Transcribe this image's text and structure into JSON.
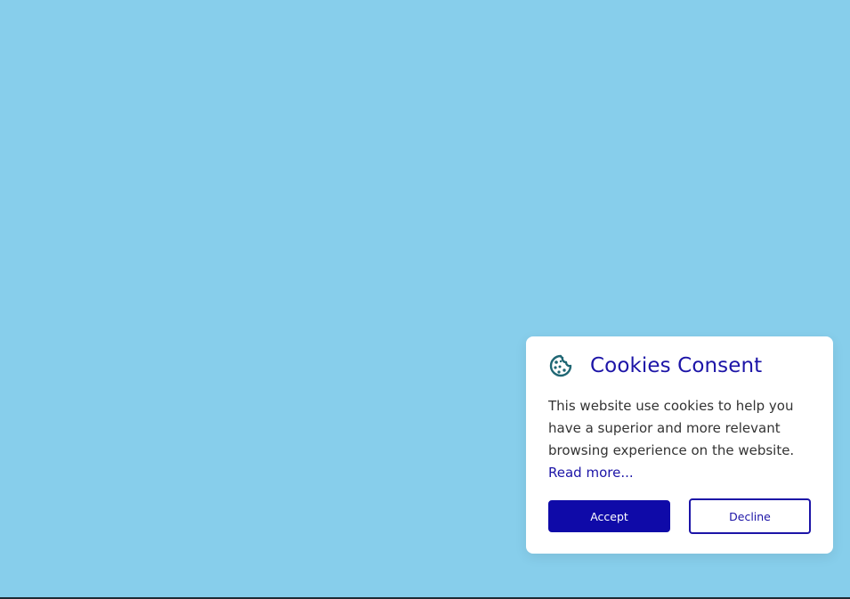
{
  "colors": {
    "page_background": "#87ceeb",
    "card_background": "#ffffff",
    "accent": "#1c14a7",
    "icon": "#1f6673",
    "body_text": "#333333"
  },
  "cookie_banner": {
    "icon": "cookie-icon",
    "title": "Cookies Consent",
    "message": "This website use cookies to help you have a superior and more relevant browsing experience on the website.",
    "read_more_label": "Read more...",
    "accept_label": "Accept",
    "decline_label": "Decline"
  }
}
